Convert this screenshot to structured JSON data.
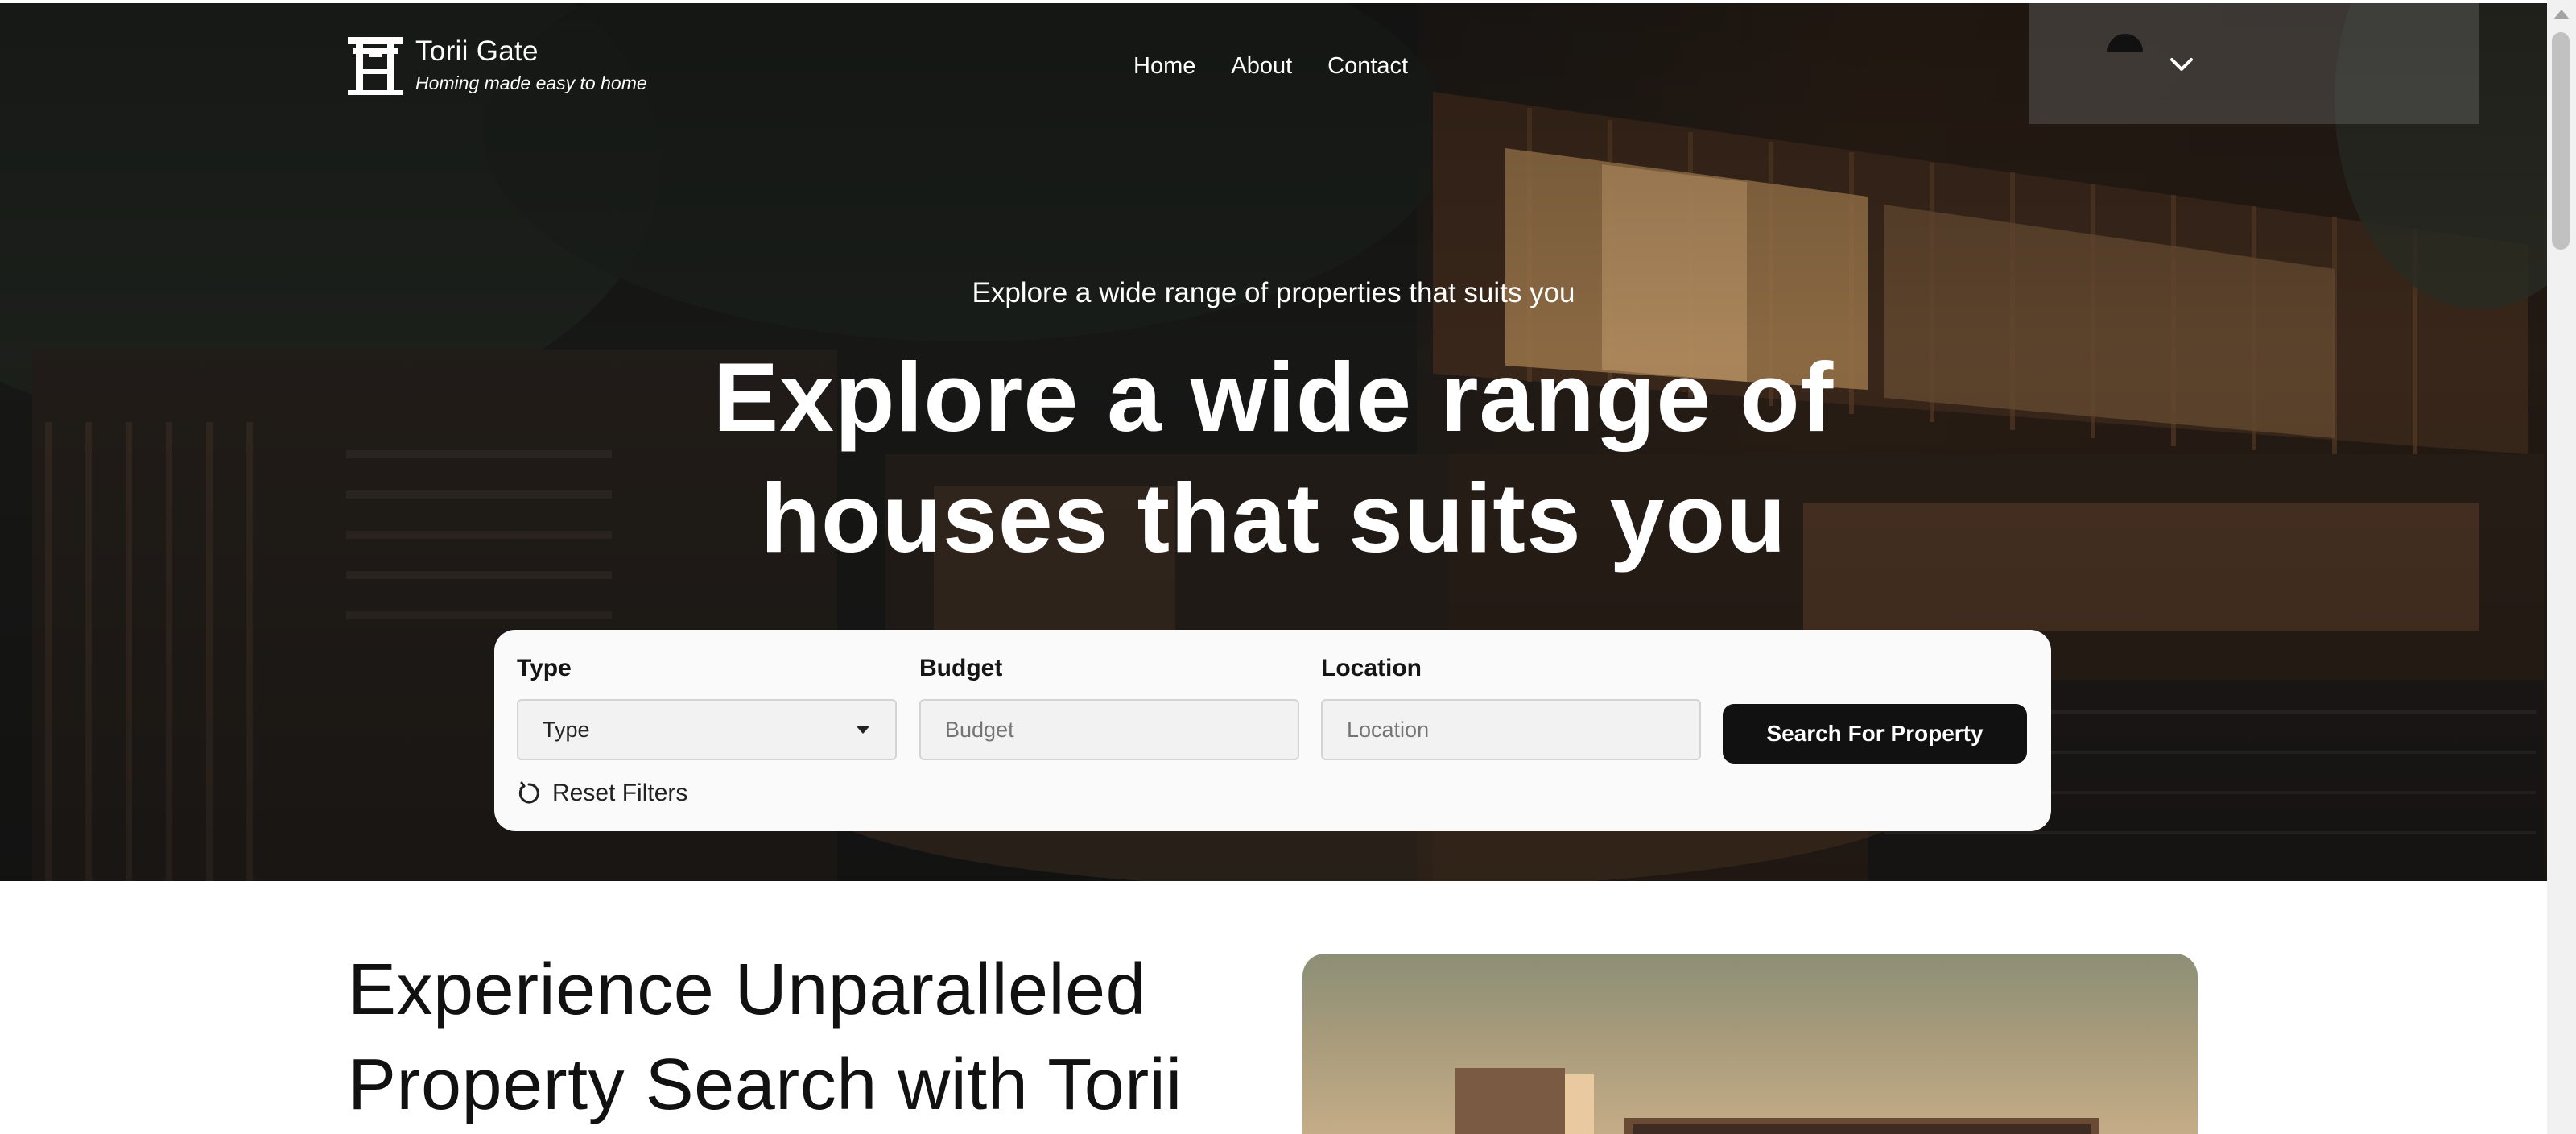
{
  "brand": {
    "name": "Torii Gate",
    "tagline": "Homing made easy to home"
  },
  "nav": {
    "links": [
      "Home",
      "About",
      "Contact"
    ]
  },
  "hero": {
    "eyebrow": "Explore a wide range of properties that suits you",
    "title_line1": "Explore a wide range of",
    "title_line2": "houses that suits you"
  },
  "search": {
    "type_label": "Type",
    "type_value": "Type",
    "budget_label": "Budget",
    "budget_placeholder": "Budget",
    "location_label": "Location",
    "location_placeholder": "Location",
    "button_label": "Search For Property",
    "reset_label": "Reset Filters"
  },
  "section": {
    "title_line1": "Experience Unparalleled",
    "title_line2": "Property Search with Torii"
  },
  "icons": {
    "logo": "torii-gate-icon",
    "user": "avatar",
    "menu": "chevron-down-icon",
    "select": "caret-down-icon",
    "reset": "reset-icon"
  },
  "colors": {
    "accent": "#111111",
    "card": "#fafafa",
    "hero_text": "#ffffff"
  }
}
